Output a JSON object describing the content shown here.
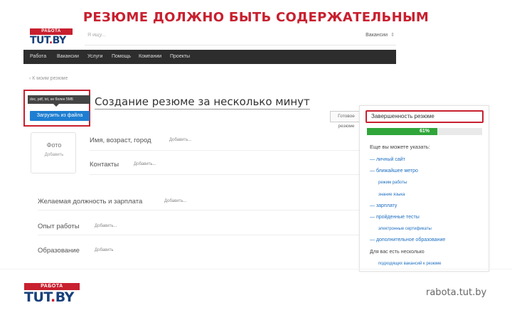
{
  "slide": {
    "title": "РЕЗЮМЕ ДОЛЖНО БЫТЬ СОДЕРЖАТЕЛЬНЫМ",
    "footer_url": "rabota.tut.by"
  },
  "logo": {
    "top": "РАБОТА",
    "bottom_a": "TUT",
    "bottom_dot": ".",
    "bottom_b": "BY"
  },
  "header": {
    "search_placeholder": "Я ищу...",
    "category": "Вакансии",
    "category_arrow": "⇕"
  },
  "nav": {
    "items": [
      "Работа",
      "Вакансии",
      "Услуги",
      "Помощь",
      "Компании",
      "Проекты"
    ]
  },
  "form": {
    "back_link": "‹ К моим резюме",
    "title": "Создание резюме за несколько минут",
    "tooltip": "doc, pdf, txt, не более 5МБ",
    "upload_button": "Загрузить из файла",
    "ready_button": "Готовое резюме",
    "photo_label": "Фото",
    "photo_add": "Добавить",
    "rows": [
      {
        "label": "Имя, возраст, город",
        "add": "Добавить..."
      },
      {
        "label": "Контакты",
        "add": "Добавить..."
      },
      {
        "label": "Желаемая должность и зарплата",
        "add": "Добавить..."
      },
      {
        "label": "Опыт работы",
        "add": "Добавить..."
      },
      {
        "label": "Образование",
        "add": "Добавить"
      }
    ]
  },
  "panel": {
    "title": "Завершенность резюме",
    "progress_value": 61,
    "progress_label": "61%",
    "progress_color": "#2fa53a",
    "accent_color": "#c8202f",
    "link_color": "#1e6fc0",
    "can_add": "Еще вы можете указать:",
    "items": [
      {
        "type": "main",
        "text": "— личный сайт"
      },
      {
        "type": "main",
        "text": "— ближайшее метро"
      },
      {
        "type": "sub",
        "text": "режим работы"
      },
      {
        "type": "sub",
        "text": "знание языка"
      },
      {
        "type": "main",
        "text": "— зарплату"
      },
      {
        "type": "main",
        "text": "— пройденные тесты"
      },
      {
        "type": "sub",
        "text": "электронные сертификаты"
      },
      {
        "type": "main",
        "text": "— дополнительное образование"
      },
      {
        "type": "plain",
        "text": "Для вас есть несколько"
      },
      {
        "type": "sub",
        "text": "подходящих вакансий к резюме"
      }
    ]
  }
}
